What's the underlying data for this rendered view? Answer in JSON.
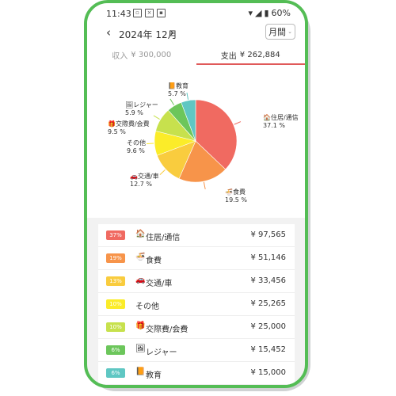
{
  "status": {
    "time": "11:43",
    "battery": "60%"
  },
  "header": {
    "prev": "‹",
    "month": "2024年 12月",
    "next": "›",
    "period": "月間"
  },
  "tabs": {
    "income_label": "収入",
    "income_amount": "¥ 300,000",
    "expense_label": "支出",
    "expense_amount": "¥ 262,884"
  },
  "chart_data": {
    "type": "pie",
    "categories": [
      "住居/通信",
      "食費",
      "交通/車",
      "その他",
      "交際費/会費",
      "レジャー",
      "教育"
    ],
    "values": [
      37.1,
      19.5,
      12.7,
      9.6,
      9.5,
      5.9,
      5.7
    ],
    "labels": [
      "37.1 %",
      "19.5 %",
      "12.7 %",
      "9.6 %",
      "9.5 %",
      "5.9 %",
      "5.7 %"
    ],
    "colors": [
      "#f06a61",
      "#f7944a",
      "#f9cc3e",
      "#fbec29",
      "#c7e14d",
      "#6cc65b",
      "#5fc7c3"
    ],
    "icons": [
      "house-icon",
      "rice-bowl-icon",
      "car-icon",
      "",
      "gift-icon",
      "picture-icon",
      "book-icon"
    ]
  },
  "legend": [
    {
      "pct": "37%",
      "icon": "🏠",
      "label": "住居/通信",
      "amount": "¥ 97,565",
      "color": "#f06a61"
    },
    {
      "pct": "19%",
      "icon": "🍜",
      "label": "食費",
      "amount": "¥ 51,146",
      "color": "#f7944a"
    },
    {
      "pct": "13%",
      "icon": "🚗",
      "label": "交通/車",
      "amount": "¥ 33,456",
      "color": "#f9cc3e"
    },
    {
      "pct": "10%",
      "icon": "",
      "label": "その他",
      "amount": "¥ 25,265",
      "color": "#fbec29"
    },
    {
      "pct": "10%",
      "icon": "🎁",
      "label": "交際費/会費",
      "amount": "¥ 25,000",
      "color": "#c7e14d"
    },
    {
      "pct": "6%",
      "icon": "🖼",
      "label": "レジャー",
      "amount": "¥ 15,452",
      "color": "#6cc65b"
    },
    {
      "pct": "6%",
      "icon": "📙",
      "label": "教育",
      "amount": "¥ 15,000",
      "color": "#5fc7c3"
    }
  ]
}
